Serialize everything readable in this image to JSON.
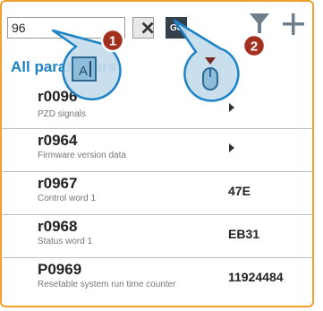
{
  "search": {
    "value": "96"
  },
  "buttons": {
    "go_label": "Go"
  },
  "list": {
    "title": "All parameters"
  },
  "callouts": [
    {
      "number": "1"
    },
    {
      "number": "2"
    }
  ],
  "rows": [
    {
      "id": "r0096",
      "description": "PZD signals",
      "value": ""
    },
    {
      "id": "r0964",
      "description": "Firmware version data",
      "value": ""
    },
    {
      "id": "r0967",
      "description": "Control word 1",
      "value": "47E"
    },
    {
      "id": "r0968",
      "description": "Status word 1",
      "value": "EB31"
    },
    {
      "id": "P0969",
      "description": "Resetable system run time counter",
      "value": "11924484"
    }
  ],
  "colors": {
    "panel_border": "#f0a030",
    "accent_blue": "#1e83c6",
    "callout_fill": "#c5dceb",
    "callout_badge": "#a2301f",
    "filter_icon": "#6e7f8b"
  },
  "icons": [
    "close-icon",
    "filter-icon",
    "plus-icon",
    "text-input-icon",
    "mouse-icon"
  ]
}
